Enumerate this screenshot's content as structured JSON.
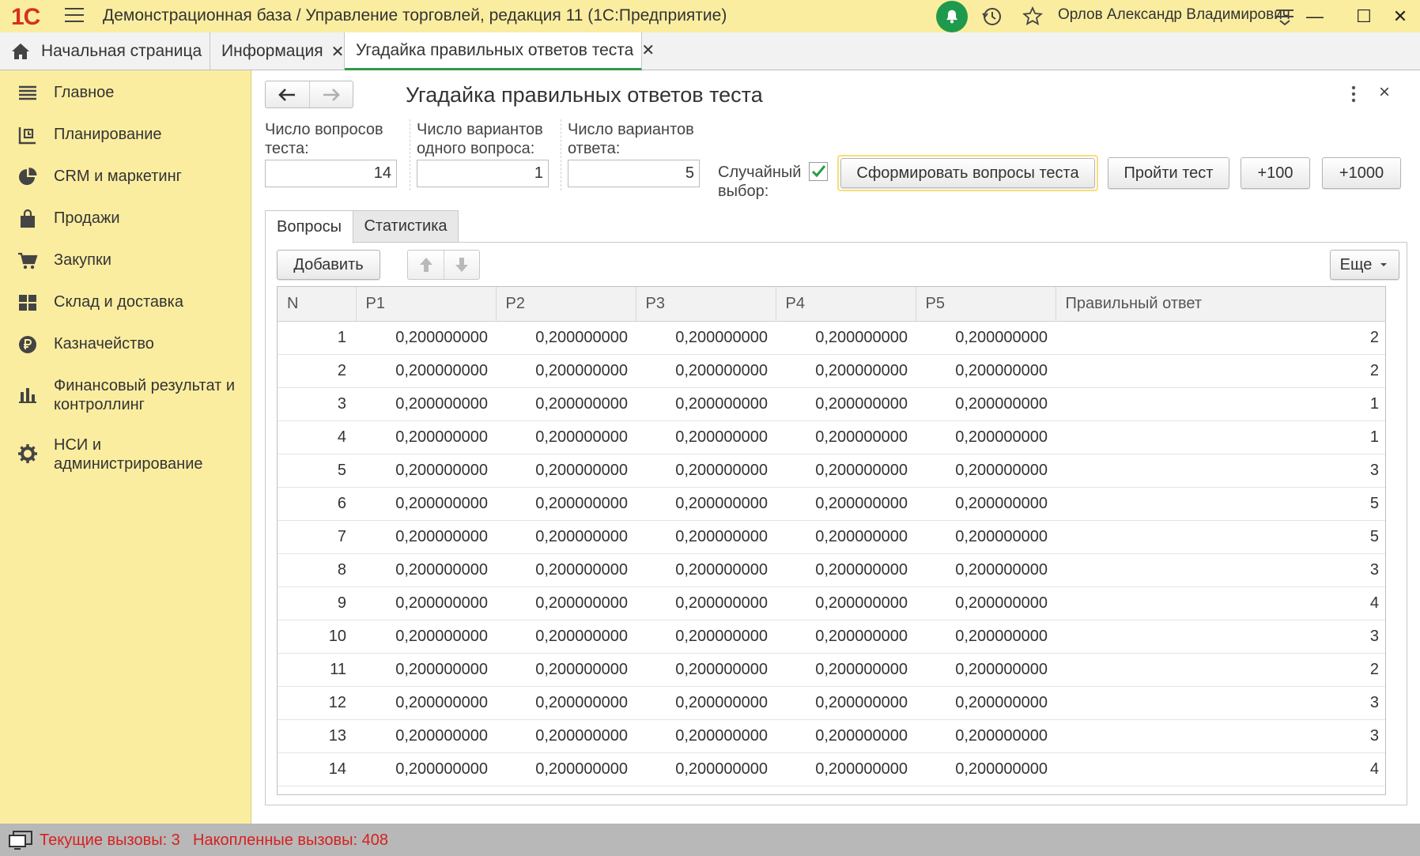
{
  "titlebar": {
    "logo": "1С",
    "title": "Демонстрационная база / Управление торговлей, редакция 11  (1С:Предприятие)",
    "user": "Орлов Александр Владимирович",
    "minimize": "—",
    "maximize": "☐",
    "close": "✕"
  },
  "tabs": [
    {
      "label": "Начальная страница",
      "icon": "home-icon"
    },
    {
      "label": "Информация",
      "close": "✕"
    },
    {
      "label": "Угадайка правильных ответов теста",
      "close": "✕",
      "active": true
    }
  ],
  "sidebar": {
    "items": [
      {
        "label": "Главное",
        "icon": "menu-lines-icon"
      },
      {
        "label": "Планирование",
        "icon": "planning-icon"
      },
      {
        "label": "CRM и маркетинг",
        "icon": "pie-chart-icon"
      },
      {
        "label": "Продажи",
        "icon": "bag-icon"
      },
      {
        "label": "Закупки",
        "icon": "cart-icon"
      },
      {
        "label": "Склад и доставка",
        "icon": "warehouse-grid-icon"
      },
      {
        "label": "Казначейство",
        "icon": "ruble-icon"
      },
      {
        "label": "Финансовый результат и контроллинг",
        "icon": "bar-chart-icon"
      },
      {
        "label": "НСИ и администрирование",
        "icon": "gear-icon"
      }
    ]
  },
  "form": {
    "title": "Угадайка правильных ответов теста",
    "close": "×",
    "fields": {
      "questions_label": "Число вопросов теста:",
      "questions_value": "14",
      "variants_label": "Число вариантов одного вопроса:",
      "variants_value": "1",
      "answers_label": "Число вариантов ответа:",
      "answers_value": "5",
      "random_label": "Случайный выбор:",
      "random_checked": true
    },
    "buttons": {
      "generate": "Сформировать вопросы теста",
      "pass": "Пройти тест",
      "plus100": "+100",
      "plus1000": "+1000"
    },
    "page_tabs": [
      {
        "label": "Вопросы",
        "active": true
      },
      {
        "label": "Статистика",
        "active": false
      }
    ],
    "toolbar": {
      "add": "Добавить",
      "more": "Еще"
    }
  },
  "grid": {
    "columns": [
      "N",
      "P1",
      "P2",
      "P3",
      "P4",
      "P5",
      "Правильный ответ"
    ],
    "rows": [
      [
        "1",
        "0,200000000",
        "0,200000000",
        "0,200000000",
        "0,200000000",
        "0,200000000",
        "2"
      ],
      [
        "2",
        "0,200000000",
        "0,200000000",
        "0,200000000",
        "0,200000000",
        "0,200000000",
        "2"
      ],
      [
        "3",
        "0,200000000",
        "0,200000000",
        "0,200000000",
        "0,200000000",
        "0,200000000",
        "1"
      ],
      [
        "4",
        "0,200000000",
        "0,200000000",
        "0,200000000",
        "0,200000000",
        "0,200000000",
        "1"
      ],
      [
        "5",
        "0,200000000",
        "0,200000000",
        "0,200000000",
        "0,200000000",
        "0,200000000",
        "3"
      ],
      [
        "6",
        "0,200000000",
        "0,200000000",
        "0,200000000",
        "0,200000000",
        "0,200000000",
        "5"
      ],
      [
        "7",
        "0,200000000",
        "0,200000000",
        "0,200000000",
        "0,200000000",
        "0,200000000",
        "5"
      ],
      [
        "8",
        "0,200000000",
        "0,200000000",
        "0,200000000",
        "0,200000000",
        "0,200000000",
        "3"
      ],
      [
        "9",
        "0,200000000",
        "0,200000000",
        "0,200000000",
        "0,200000000",
        "0,200000000",
        "4"
      ],
      [
        "10",
        "0,200000000",
        "0,200000000",
        "0,200000000",
        "0,200000000",
        "0,200000000",
        "3"
      ],
      [
        "11",
        "0,200000000",
        "0,200000000",
        "0,200000000",
        "0,200000000",
        "0,200000000",
        "2"
      ],
      [
        "12",
        "0,200000000",
        "0,200000000",
        "0,200000000",
        "0,200000000",
        "0,200000000",
        "3"
      ],
      [
        "13",
        "0,200000000",
        "0,200000000",
        "0,200000000",
        "0,200000000",
        "0,200000000",
        "3"
      ],
      [
        "14",
        "0,200000000",
        "0,200000000",
        "0,200000000",
        "0,200000000",
        "0,200000000",
        "4"
      ]
    ]
  },
  "status": {
    "current_calls": "Текущие вызовы: 3",
    "accumulated_calls": "Накопленные вызовы: 408"
  },
  "colors": {
    "sidebar_bg": "#fbeda0",
    "accent_green": "#2e9a4a",
    "status_text": "#d62121"
  }
}
